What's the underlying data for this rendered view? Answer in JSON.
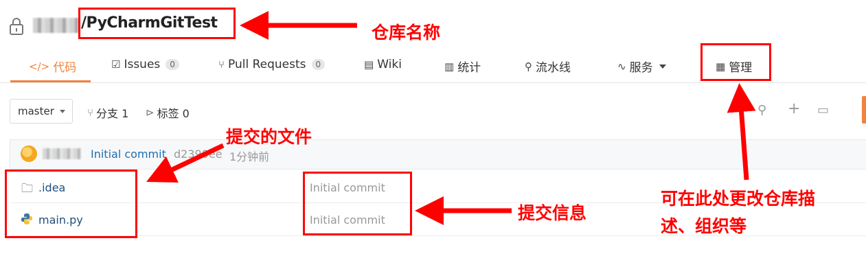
{
  "repo": {
    "name": "/PyCharmGitTest"
  },
  "tabs": [
    {
      "icon": "</>",
      "label": "代码",
      "badge": ""
    },
    {
      "icon": "☑",
      "label": "Issues",
      "badge": "0"
    },
    {
      "icon": "⑂",
      "label": "Pull Requests",
      "badge": "0"
    },
    {
      "icon": "▤",
      "label": "Wiki",
      "badge": ""
    },
    {
      "icon": "▥",
      "label": "统计",
      "badge": ""
    },
    {
      "icon": "⚲",
      "label": "流水线",
      "badge": ""
    },
    {
      "icon": "∿",
      "label": "服务",
      "badge": ""
    },
    {
      "icon": "▦",
      "label": "管理",
      "badge": ""
    }
  ],
  "branch": {
    "current": "master",
    "branches_label": "分支 1",
    "tags_label": "标签 0"
  },
  "last_commit": {
    "message": "Initial commit",
    "hash": "d2390ee",
    "time": "1分钟前"
  },
  "files": [
    {
      "name": ".idea",
      "type": "folder",
      "commit": "Initial commit"
    },
    {
      "name": "main.py",
      "type": "python",
      "commit": "Initial commit"
    }
  ],
  "annotations": {
    "repo_name": "仓库名称",
    "committed_files": "提交的文件",
    "commit_info": "提交信息",
    "manage_line1": "可在此处更改仓库描",
    "manage_line2": "述、组织等"
  },
  "colors": {
    "accent": "#f3823b",
    "annotation": "#ff0000",
    "link": "#1e6fb0"
  }
}
